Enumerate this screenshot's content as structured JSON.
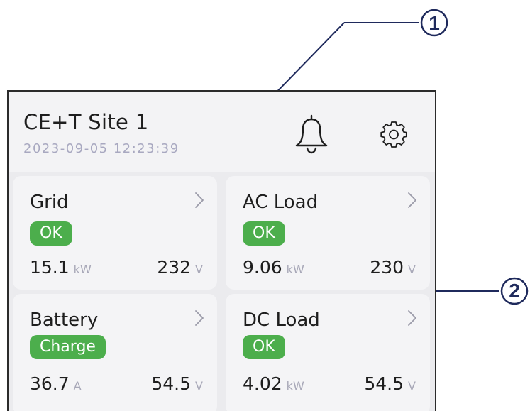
{
  "callouts": {
    "one": "1",
    "two": "2"
  },
  "header": {
    "site_name": "CE+T Site 1",
    "timestamp": "2023-09-05 12:23:39",
    "icons": {
      "notifications": "bell-icon",
      "settings": "gear-icon"
    }
  },
  "cards": {
    "grid": {
      "title": "Grid",
      "status": "OK",
      "value1": "15.1",
      "unit1": "kW",
      "value2": "232",
      "unit2": "V"
    },
    "ac_load": {
      "title": "AC Load",
      "status": "OK",
      "value1": "9.06",
      "unit1": "kW",
      "value2": "230",
      "unit2": "V"
    },
    "battery": {
      "title": "Battery",
      "status": "Charge",
      "value1": "36.7",
      "unit1": "A",
      "value2": "54.5",
      "unit2": "V"
    },
    "dc_load": {
      "title": "DC Load",
      "status": "OK",
      "value1": "4.02",
      "unit1": "kW",
      "value2": "54.5",
      "unit2": "V"
    }
  },
  "colors": {
    "status_ok": "#4cae4c",
    "callout": "#1f2a5c",
    "background": "#f3f3f5",
    "text": "#1e1e1e",
    "muted": "#a8a8c0"
  }
}
